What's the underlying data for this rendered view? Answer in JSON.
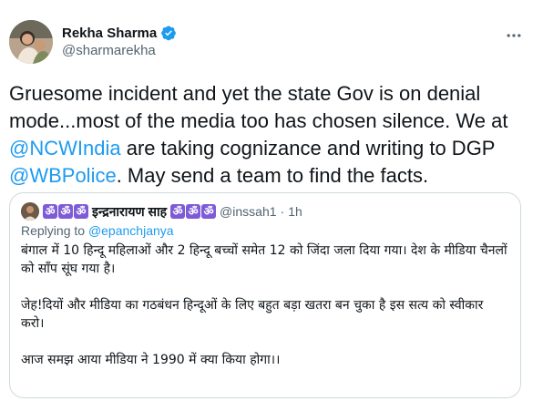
{
  "author": {
    "display_name": "Rekha Sharma",
    "handle": "@sharmarekha"
  },
  "icons": {
    "verified": "verified-badge-icon",
    "more": "more-options-icon",
    "accent": "#1d9bf0"
  },
  "tweet": {
    "part1": "Gruesome incident and yet the state Gov is on denial mode...most of the media too has chosen silence. We at ",
    "mention1": "@NCWIndia",
    "part2": " are taking cognizance and writing to DGP ",
    "mention2": "@WBPolice",
    "part3": ". May send a team to find the facts."
  },
  "quote": {
    "om_symbols": [
      "ॐ",
      "ॐ",
      "ॐ"
    ],
    "name": "इन्द्रनारायण साह",
    "om_symbols_after": [
      "ॐ",
      "ॐ",
      "ॐ"
    ],
    "handle": "@inssah1",
    "separator": "·",
    "time": "1h",
    "replying_to_label": "Replying to ",
    "replying_to_handle": "@epanchjanya",
    "text": "बंगाल में 10 हिन्दू महिलाओं और 2 हिन्दू बच्चों समेत 12 को जिंदा जला दिया गया। देश के मीडिया चैनलों को साँप सूंघ गया है।\n\nजेह!दियों और मीडिया का गठबंधन हिन्दूओं के लिए बहुत बड़ा खतरा बन चुका है इस सत्य को स्वीकार करो।\n\nआज समझ आया मीडिया ने 1990 में क्या किया होगा।।"
  }
}
